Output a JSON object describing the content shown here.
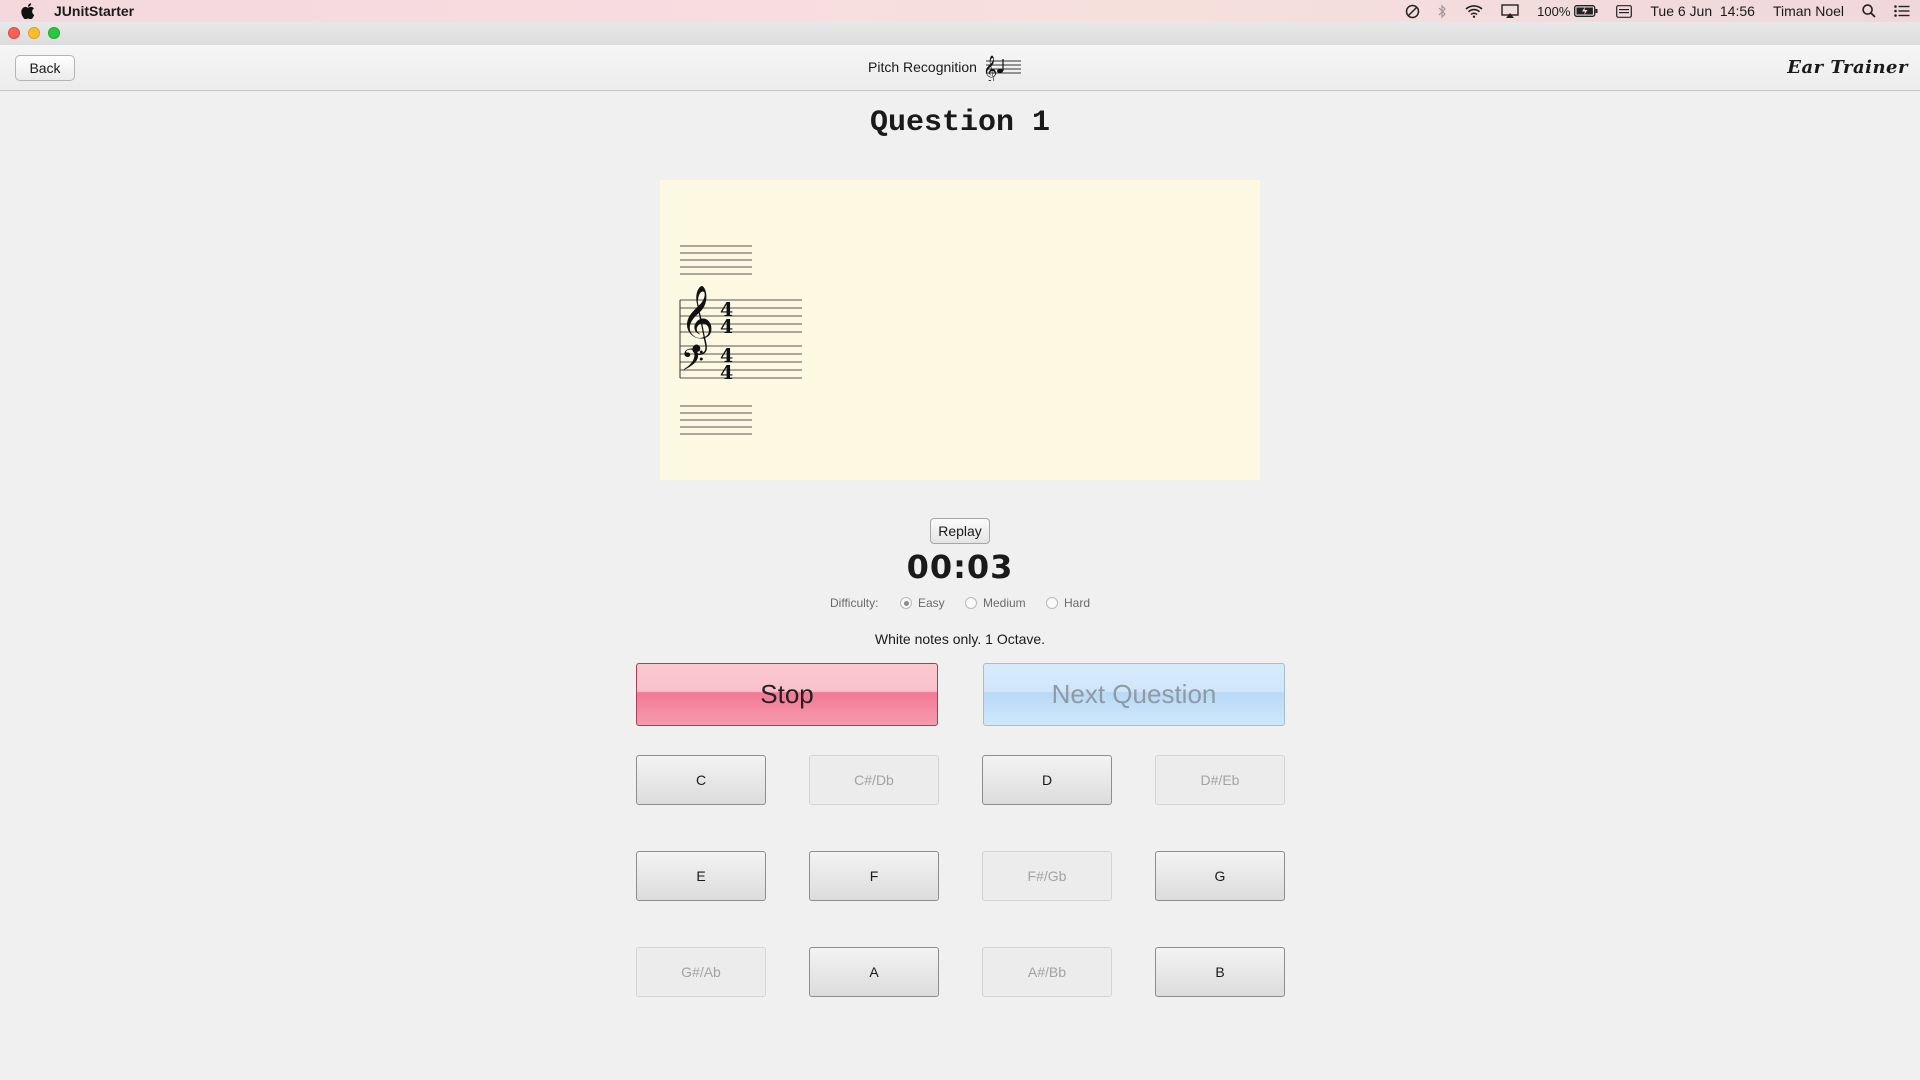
{
  "menubar": {
    "app_name": "JUnitStarter",
    "battery": "100%",
    "datetime": "Tue 6 Jun  14:56",
    "user": "Timan Noel",
    "icons": [
      "apple-icon",
      "do-not-disturb-icon",
      "bluetooth-icon",
      "wifi-icon",
      "airplay-icon",
      "battery-icon",
      "keyboard-icon",
      "spotlight-icon",
      "notification-center-icon"
    ]
  },
  "toolbar": {
    "back_label": "Back",
    "title": "Pitch Recognition",
    "brand": "Ear Trainer"
  },
  "main": {
    "question_title": "Question 1",
    "replay_label": "Replay",
    "timer": "00:03",
    "difficulty": {
      "label": "Difficulty:",
      "options": [
        "Easy",
        "Medium",
        "Hard"
      ],
      "selected": "Easy"
    },
    "description": "White notes only. 1 Octave.",
    "stop_label": "Stop",
    "next_label": "Next Question",
    "notes": [
      {
        "label": "C",
        "enabled": true
      },
      {
        "label": "C#/Db",
        "enabled": false
      },
      {
        "label": "D",
        "enabled": true
      },
      {
        "label": "D#/Eb",
        "enabled": false
      },
      {
        "label": "E",
        "enabled": true
      },
      {
        "label": "F",
        "enabled": true
      },
      {
        "label": "F#/Gb",
        "enabled": false
      },
      {
        "label": "G",
        "enabled": true
      },
      {
        "label": "G#/Ab",
        "enabled": false
      },
      {
        "label": "A",
        "enabled": true
      },
      {
        "label": "A#/Bb",
        "enabled": false
      },
      {
        "label": "B",
        "enabled": true
      }
    ]
  },
  "colors": {
    "stop": "#f27994",
    "next": "#b8d9f6",
    "staff_panel": "#fdf8e2"
  }
}
